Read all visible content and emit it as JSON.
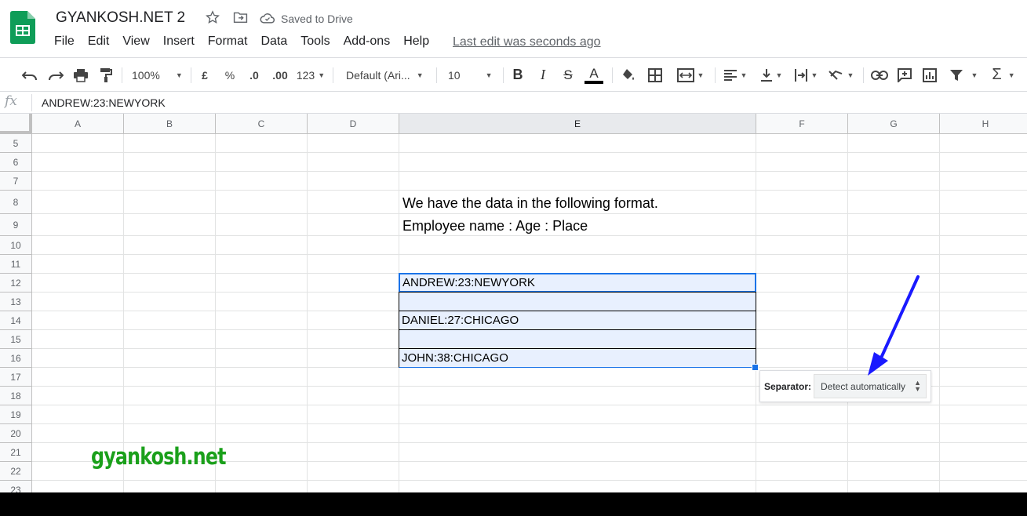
{
  "app": {
    "doc_title": "GYANKOSH.NET 2",
    "saved_status": "Saved to Drive",
    "last_edit": "Last edit was seconds ago"
  },
  "menu": [
    "File",
    "Edit",
    "View",
    "Insert",
    "Format",
    "Data",
    "Tools",
    "Add-ons",
    "Help"
  ],
  "toolbar": {
    "zoom": "100%",
    "currency": "£",
    "percent": "%",
    "dec_decrease": ".0",
    "dec_increase": ".00",
    "more_formats": "123",
    "font": "Default (Ari...",
    "font_size": "10",
    "text_color": "#000000"
  },
  "formula_bar": {
    "fx": "fx",
    "content": "ANDREW:23:NEWYORK"
  },
  "columns": [
    "A",
    "B",
    "C",
    "D",
    "E",
    "F",
    "G",
    "H"
  ],
  "selected_column": "E",
  "rows": [
    "5",
    "6",
    "7",
    "8",
    "9",
    "10",
    "11",
    "12",
    "13",
    "14",
    "15",
    "16",
    "17",
    "18",
    "19",
    "20",
    "21",
    "22",
    "23"
  ],
  "cells": {
    "e8": "We have the data in the following format.",
    "e9": "Employee name : Age : Place",
    "e12": "ANDREW:23:NEWYORK",
    "e13": "",
    "e14": "DANIEL:27:CHICAGO",
    "e15": "",
    "e16": "JOHN:38:CHICAGO"
  },
  "split_popup": {
    "label": "Separator:",
    "value": "Detect automatically"
  },
  "watermark": "gyankosh.net",
  "colors": {
    "accent_blue": "#1a73e8",
    "selection_fill": "#e8f0fe",
    "arrow": "#1a1aff",
    "watermark": "#1ba01b",
    "sheets_green": "#0f9d58"
  }
}
